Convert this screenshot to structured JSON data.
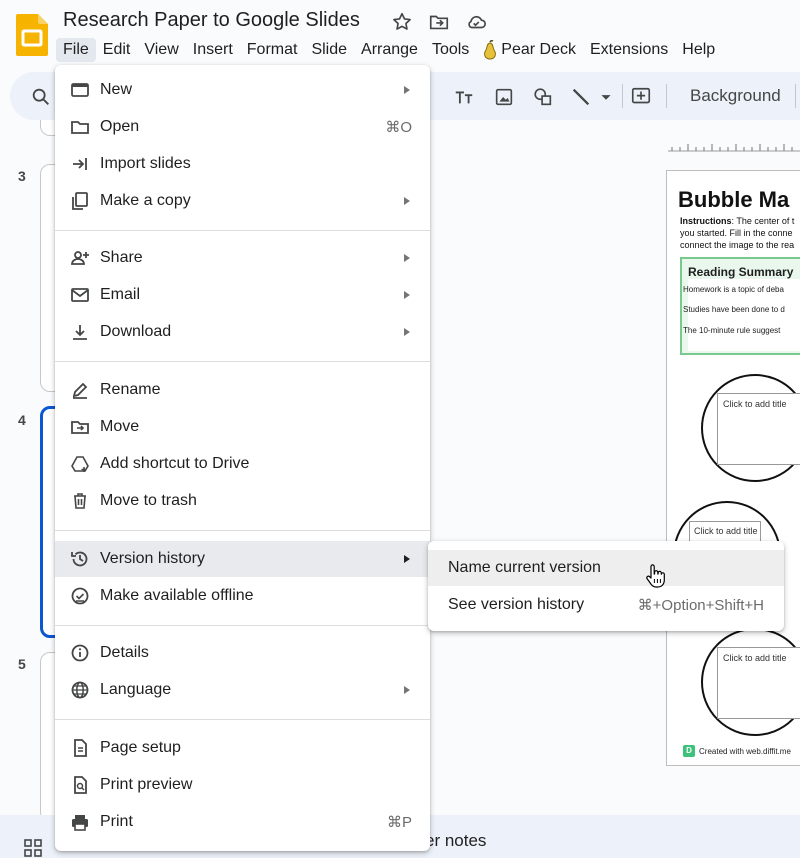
{
  "app": {
    "doc_title": "Research Paper to Google Slides",
    "logo": "google-slides-logo",
    "brand_color": "#f6b400"
  },
  "menubar": {
    "items": [
      "File",
      "Edit",
      "View",
      "Insert",
      "Format",
      "Slide",
      "Arrange",
      "Tools",
      "Pear Deck",
      "Extensions",
      "Help"
    ],
    "active": "File"
  },
  "toolbar": {
    "background_label": "Background"
  },
  "filmstrip": {
    "slide_numbers": [
      "3",
      "4",
      "5"
    ],
    "selected": "4",
    "accent_color": "#0b57d0"
  },
  "slide": {
    "heading": "Bubble Ma",
    "instructions_label": "Instructions",
    "instructions_lines": [
      ": The center of t",
      "you started. Fill in the conne",
      "connect the image to the rea"
    ],
    "summary_title": "Reading Summary",
    "summary_lines": [
      "Homework is a topic of deba",
      "Studies have been done to d",
      "The 10-minute rule suggest"
    ],
    "bubble_labels": [
      "Click to add title",
      "Click to add title",
      "Click to add title"
    ],
    "credit": "Created with web.diffit.me",
    "credit_logo": "D",
    "summary_color": "#78c98c"
  },
  "bottombar": {
    "notes_text": "er notes"
  },
  "file_menu": {
    "items": [
      {
        "label": "New",
        "icon": "new-presentation-icon",
        "submenu": true
      },
      {
        "label": "Open",
        "icon": "folder-icon",
        "shortcut": "⌘O"
      },
      {
        "label": "Import slides",
        "icon": "import-icon"
      },
      {
        "label": "Make a copy",
        "icon": "copy-icon",
        "submenu": true
      },
      {
        "label": "Share",
        "icon": "person-add-icon",
        "submenu": true
      },
      {
        "label": "Email",
        "icon": "mail-icon",
        "submenu": true
      },
      {
        "label": "Download",
        "icon": "download-icon",
        "submenu": true
      },
      {
        "label": "Rename",
        "icon": "rename-icon"
      },
      {
        "label": "Move",
        "icon": "move-folder-icon"
      },
      {
        "label": "Add shortcut to Drive",
        "icon": "drive-shortcut-icon"
      },
      {
        "label": "Move to trash",
        "icon": "trash-icon"
      },
      {
        "label": "Version history",
        "icon": "history-icon",
        "submenu": true,
        "highlighted": true
      },
      {
        "label": "Make available offline",
        "icon": "offline-check-icon"
      },
      {
        "label": "Details",
        "icon": "info-icon"
      },
      {
        "label": "Language",
        "icon": "globe-icon",
        "submenu": true
      },
      {
        "label": "Page setup",
        "icon": "page-setup-icon"
      },
      {
        "label": "Print preview",
        "icon": "print-preview-icon"
      },
      {
        "label": "Print",
        "icon": "printer-icon",
        "shortcut": "⌘P"
      }
    ]
  },
  "version_submenu": {
    "items": [
      {
        "label": "Name current version",
        "highlighted": true
      },
      {
        "label": "See version history",
        "shortcut": "⌘+Option+Shift+H"
      }
    ]
  }
}
